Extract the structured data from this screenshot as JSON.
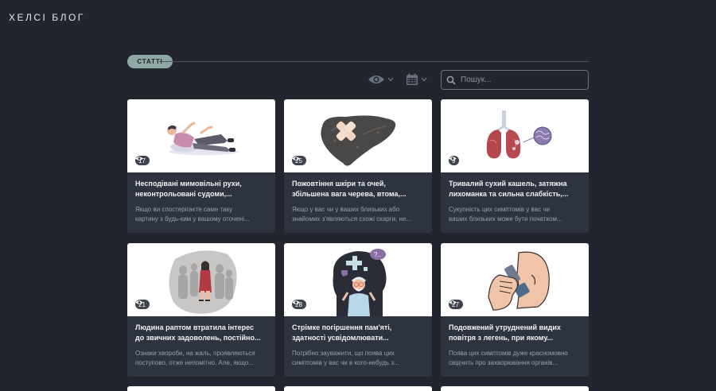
{
  "brand": {
    "logo": "ХЕЛСІ БЛОГ"
  },
  "section": {
    "label": "СТАТТІ"
  },
  "filters": {
    "views_icon": "eye-icon",
    "date_icon": "calendar-icon"
  },
  "search": {
    "placeholder": "Пошук..."
  },
  "articles": [
    {
      "views": "17",
      "title_l1": "Несподівані мимовільні рухи,",
      "title_l2": "неконтрольовані судоми,...",
      "desc_l1": "Якщо ви спостерігаєте саме таку",
      "desc_l2": "картину з будь-ким у вашому оточені...",
      "image": "person-falling-illustration"
    },
    {
      "views": "25",
      "title_l1": "Пожовтіння шкіри та очей,",
      "title_l2": "збільшена вага черева, втома,...",
      "desc_l1": "Якщо у вас чи у ваших близьких або",
      "desc_l2": "знайомих з'являються схожі скарги, не...",
      "image": "liver-illustration"
    },
    {
      "views": "9",
      "title_l1": "Тривалий сухий кашель, затяжна",
      "title_l2": "лихоманка та сильна слабкість,...",
      "desc_l1": "Сукупність цих симптомів у вас чи",
      "desc_l2": "ваших близьких може бути початком...",
      "image": "lungs-illustration"
    },
    {
      "views": "21",
      "title_l1": "Людина раптом втратила інтерес",
      "title_l2": "до звичних задоволень, постійно...",
      "desc_l1": "Ознаки хвороби, на жаль, проявляються",
      "desc_l2": "поступово, отже непомітно. Але, якщо...",
      "image": "lonely-woman-illustration"
    },
    {
      "views": "28",
      "title_l1": "Стрімке погіршення пам'яті,",
      "title_l2": "здатності усвідомлювати...",
      "desc_l1": "Потрібно зауважити, що поява цих",
      "desc_l2": "симптомів у вас чи в кого-небудь з...",
      "image": "elderly-man-memory-illustration"
    },
    {
      "views": "27",
      "title_l1": "Подовжений утруднений видих",
      "title_l2": "повітря з легень, при якому...",
      "desc_l1": "Поява цих симптомів дуже красномовно",
      "desc_l2": "свідчить про захворювання органів...",
      "image": "inhaler-illustration"
    }
  ]
}
